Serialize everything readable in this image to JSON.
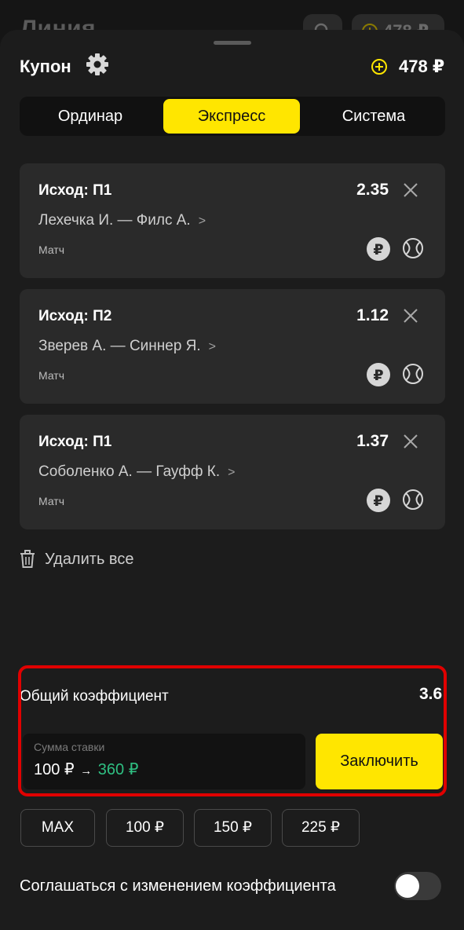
{
  "background": {
    "title": "Линия",
    "balance": "478 ₽"
  },
  "coupon": {
    "title": "Купон",
    "balance": "478 ₽",
    "tabs": [
      {
        "label": "Ординар",
        "active": false
      },
      {
        "label": "Экспресс",
        "active": true
      },
      {
        "label": "Система",
        "active": false
      }
    ],
    "bets": [
      {
        "outcome": "Исход: П1",
        "odd": "2.35",
        "match": "Лехечка И. — Филс А.",
        "type": "Матч"
      },
      {
        "outcome": "Исход: П2",
        "odd": "1.12",
        "match": "Зверев А. — Синнер Я.",
        "type": "Матч"
      },
      {
        "outcome": "Исход: П1",
        "odd": "1.37",
        "match": "Соболенко А. — Гауфф К.",
        "type": "Матч"
      }
    ],
    "delete_all": "Удалить все",
    "total_label": "Общий коэффициент",
    "total_value": "3.6",
    "stake": {
      "label": "Сумма ставки",
      "amount": "100 ₽",
      "arrow": "→",
      "win": "360 ₽"
    },
    "submit_label": "Заключить",
    "quick": [
      "MAX",
      "100 ₽",
      "150 ₽",
      "225 ₽"
    ],
    "agree_label": "Соглашаться с изменением коэффициента"
  },
  "colors": {
    "accent": "#ffe600",
    "win": "#2fbf82",
    "highlight": "#e00000"
  }
}
